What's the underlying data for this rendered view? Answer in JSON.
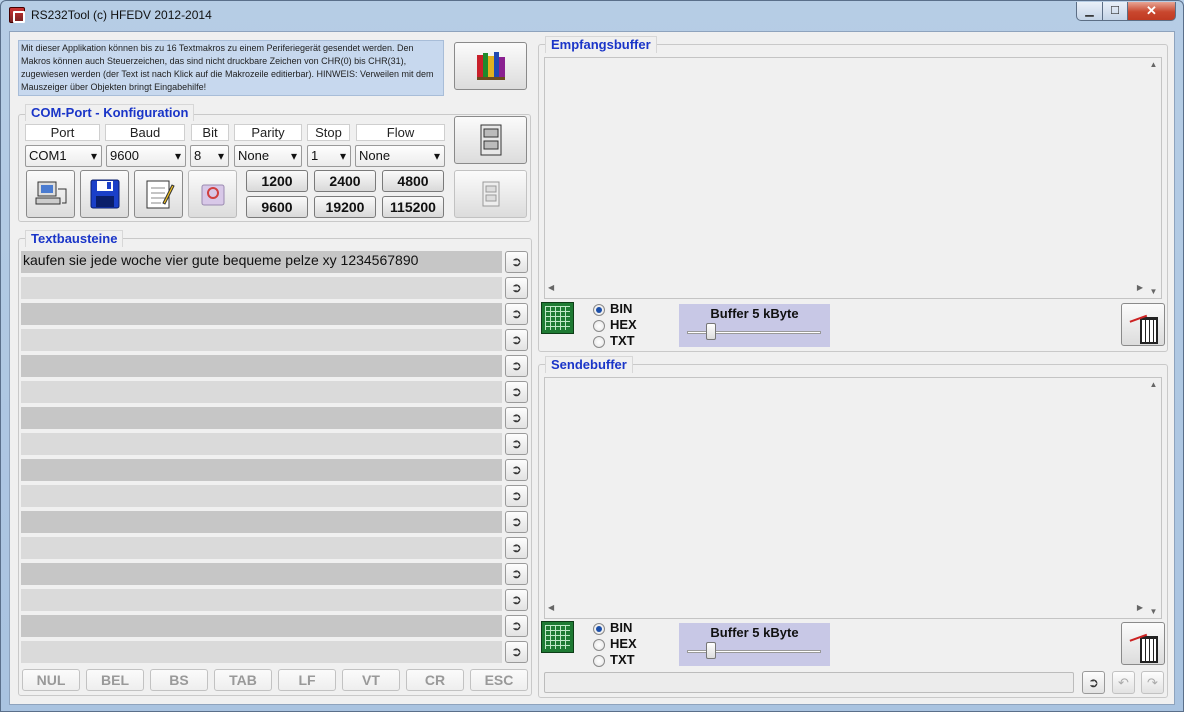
{
  "window": {
    "title": "RS232Tool (c) HFEDV 2012-2014",
    "min": "▁",
    "max": "☐",
    "close": "✕"
  },
  "info_text": "Mit dieser Applikation können bis zu 16 Textmakros zu einem Periferiegerät gesendet werden. Den Makros können auch Steuerzeichen, das sind nicht druckbare Zeichen von CHR(0) bis CHR(31), zugewiesen werden (der Text ist nach Klick auf die Makrozeile editierbar). HINWEIS: Verweilen mit dem Mauszeiger über Objekten bringt Eingabehilfe!",
  "com": {
    "title": "COM-Port - Konfiguration",
    "headers": {
      "port": "Port",
      "baud": "Baud",
      "bit": "Bit",
      "parity": "Parity",
      "stop": "Stop",
      "flow": "Flow"
    },
    "values": {
      "port": "COM1",
      "baud": "9600",
      "bit": "8",
      "parity": "None",
      "stop": "1",
      "flow": "None"
    },
    "baud_buttons": [
      "1200",
      "2400",
      "4800",
      "9600",
      "19200",
      "115200"
    ]
  },
  "textbausteine": {
    "title": "Textbausteine",
    "rows": [
      "kaufen sie jede woche vier gute bequeme pelze xy 1234567890",
      "",
      "",
      "",
      "",
      "",
      "",
      "",
      "",
      "",
      "",
      "",
      "",
      "",
      "",
      ""
    ],
    "send_symbol": "➲",
    "ctrl_chars": [
      "NUL",
      "BEL",
      "BS",
      "TAB",
      "LF",
      "VT",
      "CR",
      "ESC"
    ]
  },
  "empfang": {
    "title": "Empfangsbuffer",
    "radios": [
      "BIN",
      "HEX",
      "TXT"
    ],
    "selected": "BIN",
    "buffer_label": "Buffer 5 kByte",
    "buffer_level_fraction": 0.15
  },
  "sende": {
    "title": "Sendebuffer",
    "radios": [
      "BIN",
      "HEX",
      "TXT"
    ],
    "selected": "BIN",
    "buffer_label": "Buffer 5 kByte",
    "buffer_level_fraction": 0.15,
    "buttons": [
      "➲",
      "↶",
      "↷"
    ]
  },
  "colors": {
    "group_title": "#1a35c8",
    "info_bg": "#c7d8ee",
    "buffer_bg": "#c8c8e6"
  }
}
